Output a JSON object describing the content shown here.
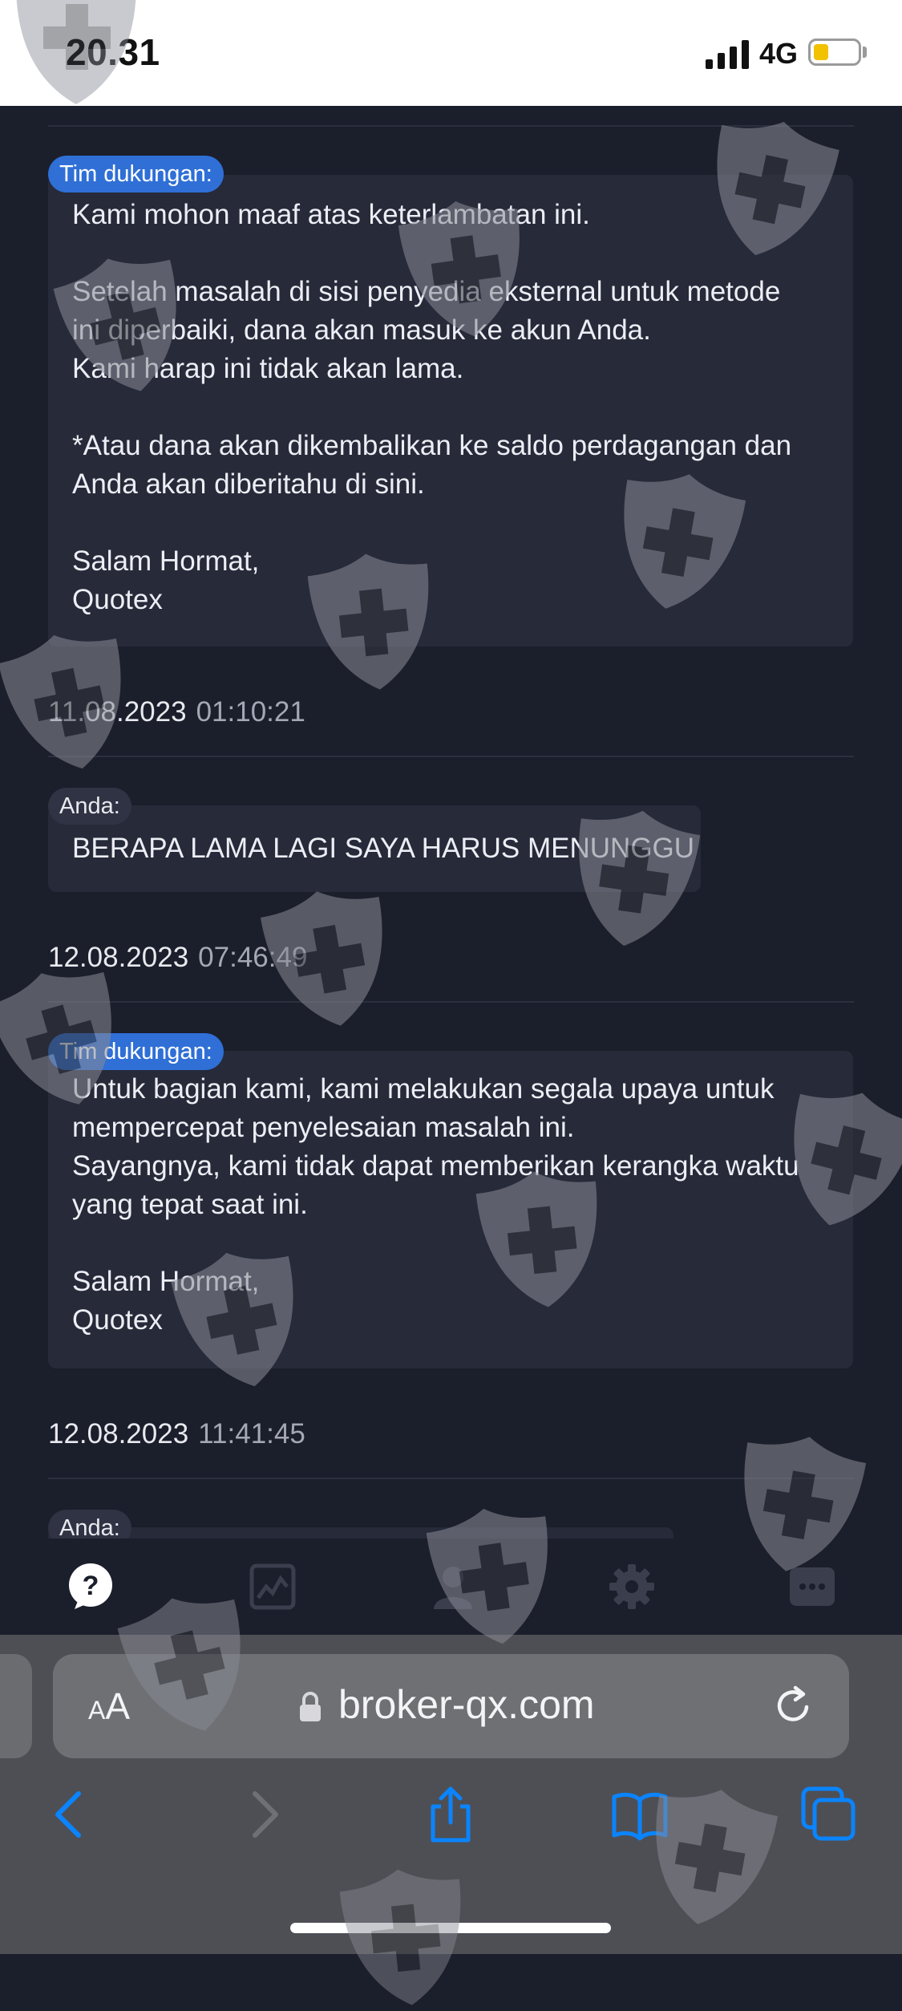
{
  "status_bar": {
    "time": "20.31",
    "network": "4G"
  },
  "messages": [
    {
      "sender": "Tim dukungan:",
      "lines": [
        "Kami mohon maaf atas keterlambatan ini.",
        "",
        "Setelah masalah di sisi penyedia eksternal untuk metode",
        "ini diperbaiki, dana akan masuk ke akun Anda.",
        "Kami harap ini tidak akan lama.",
        "",
        "*Atau dana akan dikembalikan ke saldo perdagangan dan",
        "Anda akan diberitahu di sini.",
        "",
        "Salam Hormat,",
        "Quotex"
      ],
      "date": "11.08.2023",
      "time": "01:10:21"
    },
    {
      "sender": "Anda:",
      "lines": [
        "BERAPA LAMA LAGI SAYA HARUS MENUNGGU"
      ],
      "date": "12.08.2023",
      "time": "07:46:49"
    },
    {
      "sender": "Tim dukungan:",
      "lines": [
        "Untuk bagian kami, kami melakukan segala upaya untuk",
        "mempercepat penyelesaian masalah ini.",
        "Sayangnya, kami tidak dapat memberikan kerangka waktu",
        "yang tepat saat ini.",
        "",
        "Salam Hormat,",
        "Quotex"
      ],
      "date": "12.08.2023",
      "time": "11:41:45"
    },
    {
      "sender": "Anda:",
      "lines": []
    }
  ],
  "tabbar": {
    "items": [
      "help-icon",
      "chart-icon",
      "profile-icon",
      "gear-icon",
      "more-icon"
    ],
    "active": "help-icon",
    "active_color": "#ffffff",
    "inactive_color": "#3a3e4d"
  },
  "browser": {
    "aa_label": "AA",
    "url": "broker-qx.com"
  },
  "colors": {
    "support_badge": "#2f6fd6",
    "ios_blue": "#0a84ff"
  }
}
